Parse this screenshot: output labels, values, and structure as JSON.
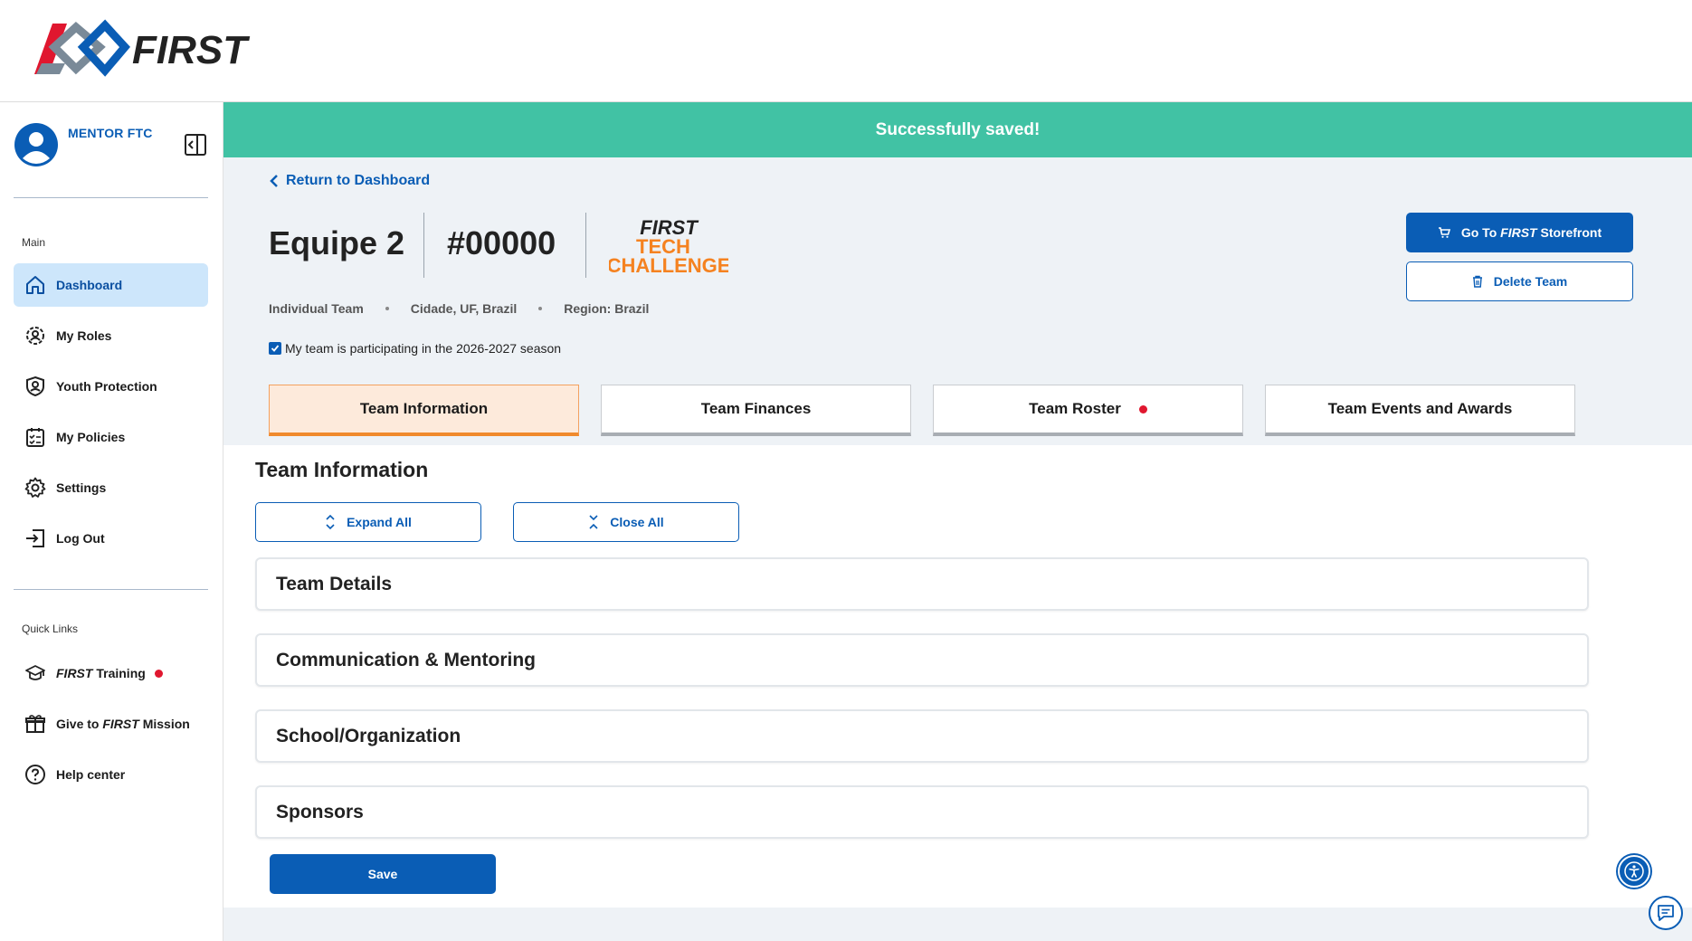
{
  "brand": {
    "logo_text": "FIRST"
  },
  "user": {
    "name": "MENTOR FTC"
  },
  "sidebar": {
    "main_label": "Main",
    "items": [
      {
        "label": "Dashboard",
        "icon": "home-icon"
      },
      {
        "label": "My Roles",
        "icon": "roles-icon"
      },
      {
        "label": "Youth Protection",
        "icon": "shield-user-icon"
      },
      {
        "label": "My Policies",
        "icon": "checklist-icon"
      },
      {
        "label": "Settings",
        "icon": "gear-icon"
      },
      {
        "label": "Log Out",
        "icon": "logout-icon"
      }
    ],
    "quick_links_label": "Quick Links",
    "quick_links": [
      {
        "label_italic": "FIRST",
        "label_rest": " Training",
        "icon": "graduation-cap-icon"
      },
      {
        "label_pre": "Give to ",
        "label_italic": "FIRST",
        "label_rest": " Mission",
        "icon": "gift-icon"
      },
      {
        "label": "Help center",
        "icon": "help-icon"
      }
    ]
  },
  "toast": {
    "message": "Successfully saved!"
  },
  "header": {
    "back_label": "Return to Dashboard",
    "team_name": "Equipe 2",
    "team_number": "#00000",
    "program_logo": {
      "line1": "FIRST",
      "line2": "TECH",
      "line3": "CHALLENGE"
    },
    "meta": [
      "Individual Team",
      "Cidade, UF, Brazil",
      "Region: Brazil"
    ],
    "season_label": "My team is participating in the 2026-2027 season",
    "season_checked": true,
    "storefront_pre": "Go To ",
    "storefront_italic": "FIRST",
    "storefront_rest": " Storefront",
    "delete_label": "Delete Team"
  },
  "tabs": [
    {
      "label": "Team Information",
      "active": true
    },
    {
      "label": "Team Finances"
    },
    {
      "label": "Team Roster",
      "alert": true
    },
    {
      "label": "Team Events and Awards"
    }
  ],
  "content": {
    "title": "Team Information",
    "expand_label": "Expand All",
    "close_label": "Close All",
    "panels": [
      "Team Details",
      "Communication & Mentoring",
      "School/Organization",
      "Sponsors"
    ],
    "save_label": "Save"
  },
  "colors": {
    "brand_blue": "#0a5db5",
    "toast_green": "#41c2a4",
    "ftc_orange": "#f58220",
    "alert_red": "#e0172f"
  }
}
